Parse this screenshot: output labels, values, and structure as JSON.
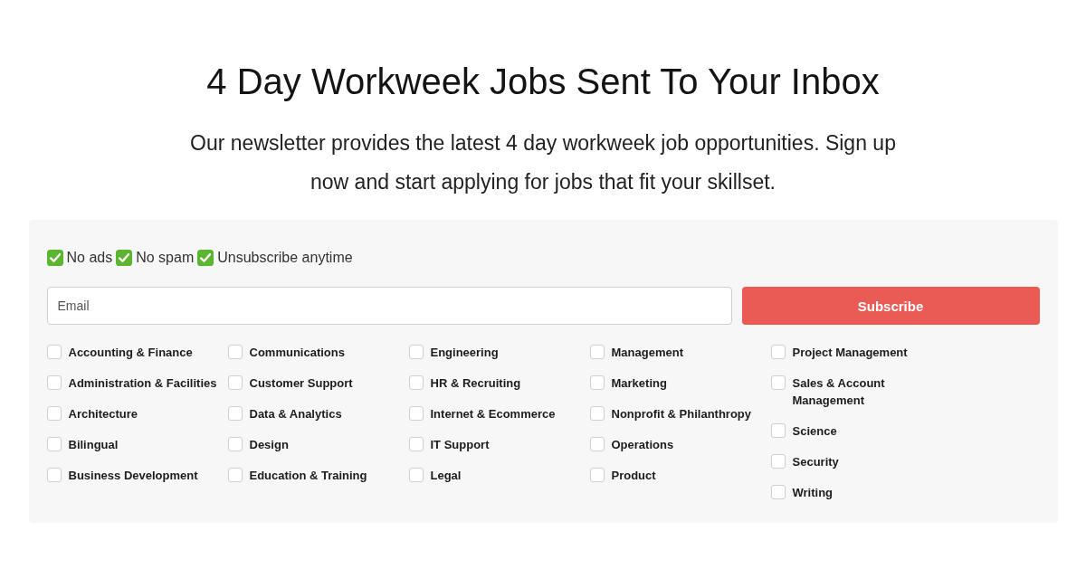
{
  "header": {
    "title": "4 Day Workweek Jobs Sent To Your Inbox",
    "intro": "Our newsletter provides the latest 4 day workweek job opportunities. Sign up now and start applying for jobs that fit your skillset."
  },
  "form": {
    "perks": [
      "No ads",
      "No spam",
      "Unsubscribe anytime"
    ],
    "email": {
      "placeholder": "Email"
    },
    "submit": "Subscribe",
    "category_columns": [
      [
        {
          "label": "Accounting & Finance",
          "checked": false
        },
        {
          "label": "Administration & Facilities",
          "checked": false
        },
        {
          "label": "Architecture",
          "checked": false
        },
        {
          "label": "Bilingual",
          "checked": false
        },
        {
          "label": "Business Development",
          "checked": false
        }
      ],
      [
        {
          "label": "Communications",
          "checked": false
        },
        {
          "label": "Customer Support",
          "checked": false
        },
        {
          "label": "Data & Analytics",
          "checked": false
        },
        {
          "label": "Design",
          "checked": false
        },
        {
          "label": "Education & Training",
          "checked": false
        }
      ],
      [
        {
          "label": "Engineering",
          "checked": false
        },
        {
          "label": "HR & Recruiting",
          "checked": false
        },
        {
          "label": "Internet & Ecommerce",
          "checked": false
        },
        {
          "label": "IT Support",
          "checked": false
        },
        {
          "label": "Legal",
          "checked": false
        }
      ],
      [
        {
          "label": "Management",
          "checked": false
        },
        {
          "label": "Marketing",
          "checked": false
        },
        {
          "label": "Nonprofit & Philanthropy",
          "checked": false
        },
        {
          "label": "Operations",
          "checked": false
        },
        {
          "label": "Product",
          "checked": false
        }
      ],
      [
        {
          "label": "Project Management",
          "checked": false
        },
        {
          "label": "Sales & Account Management",
          "checked": false
        },
        {
          "label": "Science",
          "checked": false
        },
        {
          "label": "Security",
          "checked": false
        },
        {
          "label": "Writing",
          "checked": false
        }
      ]
    ]
  }
}
